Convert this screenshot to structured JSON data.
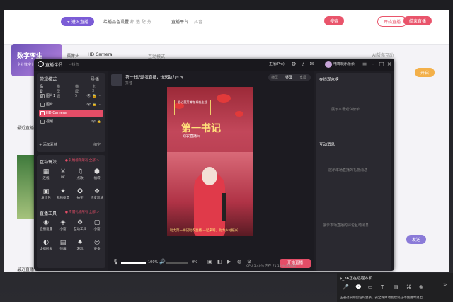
{
  "background_page": {
    "tab_button": "+ 进入直播",
    "category_label": "给播品色设置",
    "category_value": "云 都 选 配 分",
    "platform_label": "直播平台",
    "platform_value": "抖音",
    "red_btn": "搜索",
    "start_btn": "开始直播",
    "end_btn": "结束直播",
    "camera_label": "摄像头",
    "camera_value": "HD Camera",
    "interactive_label": "互动模式",
    "anchor_label": "AI帮你互动",
    "open_btn": "开启",
    "logo_text": "数字孪生",
    "logo_sub": "企业数字化转型",
    "recent_label": "最近直播",
    "recent_label2": "最近直播",
    "send_btn": "发送"
  },
  "app": {
    "name": "直播伴侣",
    "version": "- 抖音",
    "host": "主播(Pro)",
    "user": "电嘴玩乐余余",
    "titlebar_icons": [
      "gear-icon",
      "help-icon",
      "mail-icon",
      "menu-icon",
      "minimize-icon",
      "maximize-icon",
      "close-icon"
    ]
  },
  "scenes": {
    "mode_label": "常规模式",
    "mode_btn": "导播",
    "tabs": [
      "场景切",
      "横屏源",
      "横屏5",
      "卡3"
    ],
    "rows": [
      {
        "label": "图片1",
        "right": "👁 🔒 ⋯"
      },
      {
        "label": "图片",
        "right": "👁 🔒 ⋯"
      },
      {
        "label": "HD Camera",
        "right": ""
      },
      {
        "label": "视频",
        "right": "👁 🔒"
      }
    ],
    "add_material": "+ 添加素材",
    "add_right": "缩空"
  },
  "tools": {
    "play_title": "互动玩法",
    "play_hint": "● 礼物榜单所有 全部 >",
    "play_items": [
      {
        "glyph": "▦",
        "label": "连线"
      },
      {
        "glyph": "⚔",
        "label": "PK"
      },
      {
        "glyph": "♫",
        "label": "点歌"
      },
      {
        "glyph": "⬢",
        "label": "福袋"
      },
      {
        "glyph": "▣",
        "label": "发红包"
      },
      {
        "glyph": "✦",
        "label": "礼物投票"
      },
      {
        "glyph": "✪",
        "label": "抽奖"
      },
      {
        "glyph": "❖",
        "label": "连麦玩法"
      }
    ],
    "tool_title": "直播工具",
    "tool_hint": "● 专属礼物所有 全部 >",
    "tool_items": [
      {
        "glyph": "◉",
        "label": "直播设置"
      },
      {
        "glyph": "◈",
        "label": "小窗"
      },
      {
        "glyph": "⚙",
        "label": "互动工具"
      },
      {
        "glyph": "▢",
        "label": "小窗"
      },
      {
        "glyph": "◐",
        "label": "虚拟形象"
      },
      {
        "glyph": "▤",
        "label": "弹幕"
      },
      {
        "glyph": "♠",
        "label": "游戏"
      },
      {
        "glyph": "◎",
        "label": "更多"
      }
    ]
  },
  "preview": {
    "title": "第一书记助农直播，快来助力~ ✎",
    "subtitle": "抖音",
    "orientations": [
      "横屏",
      "竖屏",
      "宽屏"
    ],
    "active_orientation": 1,
    "sign_text": "爱心蔬菜博物\n绿色生活",
    "calli": "第一书记",
    "calli_sub": "助农直播间",
    "caption": "助力第一书记助农直播 一起来吧，助力乡村振兴"
  },
  "controls": {
    "volume": 100,
    "volume_label": "100%",
    "speaker_volume": 0,
    "speaker_label": "0%",
    "start_live": "开始直播"
  },
  "right": {
    "audience_title": "在线观众榜",
    "audience_empty": "展示本场观众榜单",
    "interact_title": "互动消息",
    "interact_empty1": "展示本场直播的礼物消息",
    "interact_empty2": "展示本场直播的评论互动消息",
    "stats": "CPU 5.40%  内存 71.10%  帧数30"
  },
  "tray": {
    "title": "$_36正在远程本机",
    "icons": [
      "mic-icon",
      "chat-icon",
      "screen-icon",
      "text-icon",
      "folder-icon",
      "cmd-icon",
      "close-icon"
    ],
    "message": "正通过长期验证码登录，安全保障功能建议在不使用时退出"
  }
}
